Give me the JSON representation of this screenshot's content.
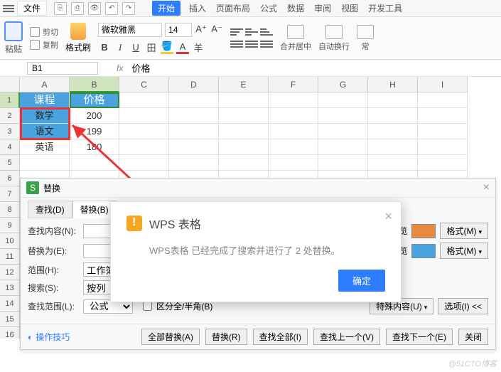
{
  "menu": {
    "file": "文件"
  },
  "tabs": {
    "start": "开始",
    "insert": "插入",
    "layout": "页面布局",
    "formula": "公式",
    "data": "数据",
    "review": "审阅",
    "view": "视图",
    "dev": "开发工具"
  },
  "ribbon": {
    "paste": "粘贴",
    "cut": "剪切",
    "copy": "复制",
    "format_painter": "格式刷",
    "font_name": "微软雅黑",
    "font_size": "14",
    "merge": "合并居中",
    "wrap": "自动换行",
    "misc": "常"
  },
  "formula": {
    "name_box": "B1",
    "fx": "fx",
    "value": "价格"
  },
  "columns": [
    "A",
    "B",
    "C",
    "D",
    "E",
    "F",
    "G",
    "H",
    "I"
  ],
  "rows_visible": 17,
  "data": {
    "r1": {
      "a": "课程",
      "b": "价格"
    },
    "r2": {
      "a": "数学",
      "b": "200"
    },
    "r3": {
      "a": "语文",
      "b": "199"
    },
    "r4": {
      "a": "英语",
      "b": "180"
    }
  },
  "dialog": {
    "title": "替换",
    "tab_find": "查找(D)",
    "tab_replace": "替换(B)",
    "find_label": "查找内容(N):",
    "replace_label": "替换为(E):",
    "find_value": "",
    "replace_value": "",
    "swatch_find": "#e88b3e",
    "swatch_replace": "#4aa3df",
    "format_btn": "格式(M)",
    "scope_label": "范围(H):",
    "scope_value": "工作簿",
    "search_label": "搜索(S):",
    "search_value": "按列",
    "lookin_label": "查找范围(L):",
    "lookin_value": "公式",
    "halfwidth": "区分全/半角(B)",
    "special": "特殊内容(U)",
    "options": "选项(I) <<",
    "preview": "览",
    "tips": "操作技巧",
    "replace_all": "全部替换(A)",
    "replace": "替换(R)",
    "find_all": "查找全部(I)",
    "find_prev": "查找上一个(V)",
    "find_next": "查找下一个(E)",
    "close": "关闭"
  },
  "popup": {
    "title": "WPS 表格",
    "message": "WPS表格 已经完成了搜索并进行了 2 处替换。",
    "ok": "确定"
  },
  "watermark": "@51CTO博客"
}
